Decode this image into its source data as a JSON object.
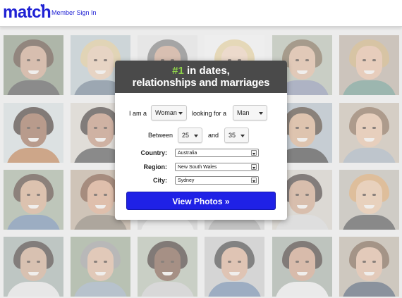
{
  "header": {
    "logo": "match",
    "logo_icon": "heart-icon",
    "sign_in": "Member Sign In"
  },
  "colors": {
    "brand": "#1f21d4",
    "accent_green": "#8ed04a",
    "card_header": "#4a4a4a",
    "cta": "#1f21e6"
  },
  "card": {
    "headline_number": "#1",
    "headline_rest": " in dates,",
    "headline_line2": "relationships and marriages",
    "i_am_label": "I am a",
    "i_am_value": "Woman",
    "looking_label": "looking for a",
    "looking_value": "Man",
    "between_label": "Between",
    "age_min": "25",
    "and_label": "and",
    "age_max": "35",
    "country_label": "Country:",
    "country_value": "Australia",
    "region_label": "Region:",
    "region_value": "New South Wales",
    "city_label": "City:",
    "city_value": "Sydney",
    "cta_label": "View Photos »"
  },
  "photos": [
    {
      "bg": "#7d8a74",
      "skin": "#c79a7e",
      "hair": "#4a3326",
      "shirt": "#3d3d3d"
    },
    {
      "bg": "#b4c4c8",
      "skin": "#e4c2a4",
      "hair": "#d9c28a",
      "shirt": "#5b6f84"
    },
    {
      "bg": "#e2e2e2",
      "skin": "#c89c82",
      "hair": "#6c6c6c",
      "shirt": "#ffffff"
    },
    {
      "bg": "#f0f0f0",
      "skin": "#eccdb2",
      "hair": "#e0c98e",
      "shirt": "#e7e7e7"
    },
    {
      "bg": "#aeb7a6",
      "skin": "#d9ad8e",
      "hair": "#6e5a3e",
      "shirt": "#7d86a4"
    },
    {
      "bg": "#b3a596",
      "skin": "#e3b595",
      "hair": "#c7a46a",
      "shirt": "#5c8a7e"
    },
    {
      "bg": "#cfd9db",
      "skin": "#8e5a3e",
      "hair": "#2b1e18",
      "shirt": "#b46e3a"
    },
    {
      "bg": "#d7d2c8",
      "skin": "#b88368",
      "hair": "#2a221e",
      "shirt": "#3b3b3b"
    },
    {
      "bg": "#cfcfcf",
      "skin": "#d9b496",
      "hair": "#8a6b4e",
      "shirt": "#8a8a8a"
    },
    {
      "bg": "#c7c2bb",
      "skin": "#deb89a",
      "hair": "#5b4532",
      "shirt": "#b5b5b5"
    },
    {
      "bg": "#a8b5c0",
      "skin": "#d4a47e",
      "hair": "#3a2a1e",
      "shirt": "#2b2b2b"
    },
    {
      "bg": "#c4b6a6",
      "skin": "#e3b897",
      "hair": "#7a5a3e",
      "shirt": "#9aa6b3"
    },
    {
      "bg": "#99a893",
      "skin": "#cfa07f",
      "hair": "#3e2b20",
      "shirt": "#5c7aa0"
    },
    {
      "bg": "#b8a48e",
      "skin": "#d59b78",
      "hair": "#6e3e26",
      "shirt": "#7a6e5e"
    },
    {
      "bg": "#d0d0d0",
      "skin": "#dab193",
      "hair": "#7c6048",
      "shirt": "#e8e8e8"
    },
    {
      "bg": "#c9c9c9",
      "skin": "#d8ad8c",
      "hair": "#5b4536",
      "shirt": "#a0a0a0"
    },
    {
      "bg": "#cfcac2",
      "skin": "#c99a7b",
      "hair": "#2e2420",
      "shirt": "#d3d3d3"
    },
    {
      "bg": "#b9b2a8",
      "skin": "#e5bc98",
      "hair": "#d49a5a",
      "shirt": "#3a3a3a"
    },
    {
      "bg": "#9aa8a2",
      "skin": "#c99e82",
      "hair": "#2d2320",
      "shirt": "#e4e4e4"
    },
    {
      "bg": "#8e9f86",
      "skin": "#d9ae90",
      "hair": "#8e8e8e",
      "shirt": "#8ca0b3"
    },
    {
      "bg": "#aeb8a7",
      "skin": "#6e4632",
      "hair": "#2a1e18",
      "shirt": "#c8c8c8"
    },
    {
      "bg": "#c3c3c3",
      "skin": "#d6a587",
      "hair": "#2c2c2c",
      "shirt": "#5d7aa0"
    },
    {
      "bg": "#9aa49a",
      "skin": "#c99476",
      "hair": "#2a1f1a",
      "shirt": "#e9e9e9"
    },
    {
      "bg": "#b7ab9c",
      "skin": "#dcb093",
      "hair": "#6b4e36",
      "shirt": "#3b4a5e"
    }
  ]
}
